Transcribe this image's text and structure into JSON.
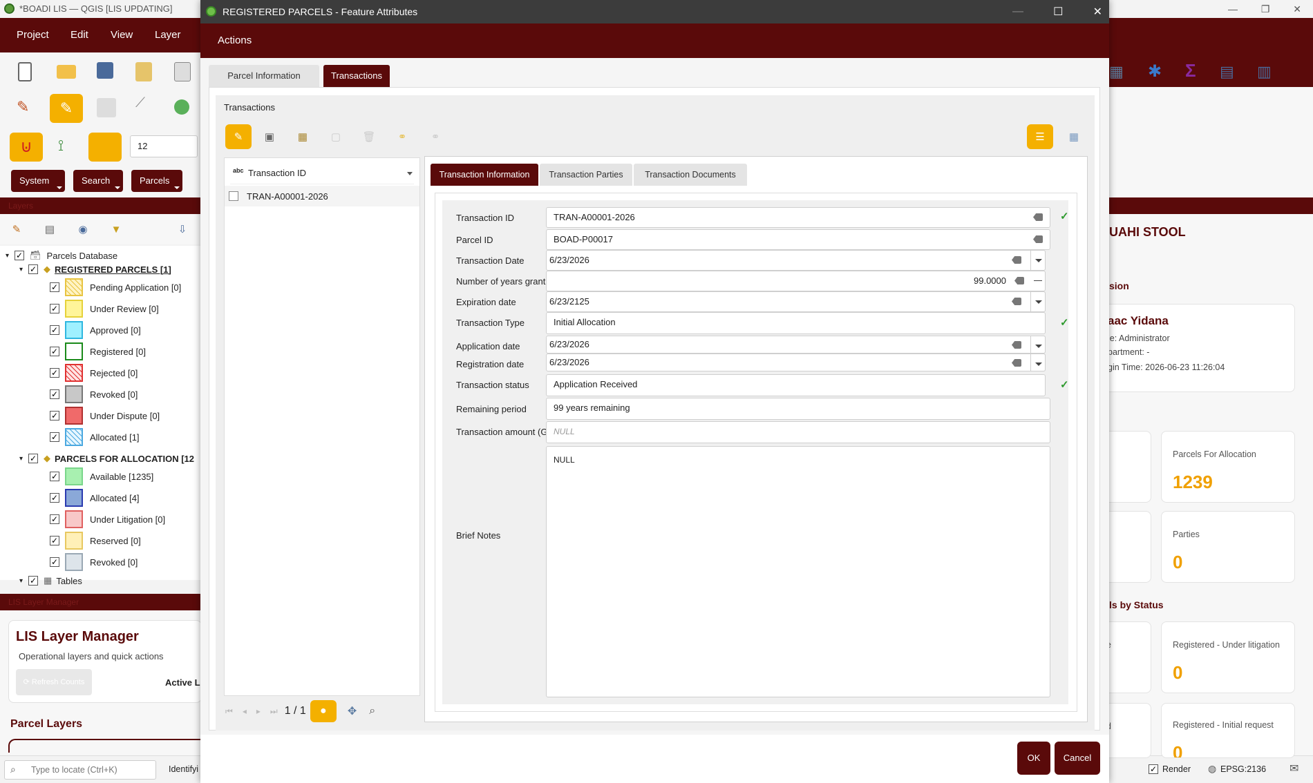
{
  "main_window": {
    "title": "*BOADI LIS — QGIS [LIS UPDATING]",
    "menu": [
      "Project",
      "Edit",
      "View",
      "Layer"
    ],
    "scale_value": "12",
    "quick_buttons": [
      "System",
      "Search",
      "Parcels"
    ],
    "layers_panel_title": "Layers",
    "layer_tree": {
      "root": "Parcels Database",
      "groups": [
        {
          "name": "REGISTERED PARCELS [1]",
          "items": [
            {
              "label": "Pending Application [0]",
              "color": "#fff3c4",
              "border": "#e8c440"
            },
            {
              "label": "Under Review [0]",
              "color": "#fff59a",
              "border": "#e6d23a"
            },
            {
              "label": "Approved [0]",
              "color": "#9ff0ff",
              "border": "#2fb7e0"
            },
            {
              "label": "Registered [0]",
              "color": "#ffffff",
              "border": "#1a8a1a"
            },
            {
              "label": "Rejected [0]",
              "color": "#ffe2e2",
              "border": "#e03030"
            },
            {
              "label": "Revoked [0]",
              "color": "#c8c8c8",
              "border": "#777777"
            },
            {
              "label": "Under Dispute [0]",
              "color": "#f06a6a",
              "border": "#b03030"
            },
            {
              "label": "Allocated [1]",
              "color": "#e6f6ff",
              "border": "#4aa8e0"
            }
          ]
        },
        {
          "name": "PARCELS FOR ALLOCATION [12",
          "items": [
            {
              "label": "Available [1235]",
              "color": "#a8f0b0",
              "border": "#7ad68a"
            },
            {
              "label": "Allocated [4]",
              "color": "#8aa8d8",
              "border": "#2a3ab0"
            },
            {
              "label": "Under Litigation [0]",
              "color": "#f8c8c8",
              "border": "#e06060"
            },
            {
              "label": "Reserved [0]",
              "color": "#fff0b8",
              "border": "#e8c860"
            },
            {
              "label": "Revoked [0]",
              "color": "#dde4ea",
              "border": "#9aa8b4"
            }
          ]
        }
      ],
      "tables_label": "Tables"
    },
    "layer_manager": {
      "panel_title": "LIS Layer Manager",
      "heading": "LIS Layer Manager",
      "subtitle": "Operational layers and quick actions",
      "refresh_button": "⟳ Refresh Counts",
      "active_label": "Active La",
      "parcel_layers_heading": "Parcel Layers"
    },
    "status_bar": {
      "locate_placeholder": "Type to locate (Ctrl+K)",
      "identify_label": "Identifyi",
      "render_label": "Render",
      "crs": "EPSG:2136"
    }
  },
  "dashboard": {
    "stool_name": "UAHI STOOL",
    "section_session": "sion",
    "user_name": "aac Yidana",
    "role": "le: Administrator",
    "department": "partment: -",
    "login_time": "gin Time: 2026-06-23 11:26:04",
    "status_heading": "ls by Status",
    "cards": [
      {
        "label": "Parcels For Allocation",
        "value": "1239"
      },
      {
        "label": "Parties",
        "value": "0"
      },
      {
        "label": "Registered - Under litigation",
        "value": "0"
      },
      {
        "label": "Registered - Initial request",
        "value": "0"
      }
    ],
    "partial_labels": [
      "e",
      "d"
    ],
    "accent": "#f0a000"
  },
  "dialog": {
    "title": "REGISTERED PARCELS - Feature Attributes",
    "actions_label": "Actions",
    "top_tabs": [
      "Parcel Information",
      "Transactions"
    ],
    "active_top_tab": "Transactions",
    "section_label": "Transactions",
    "list_header": "Transaction ID",
    "list_prefix": "abc",
    "records": [
      "TRAN-A00001-2026"
    ],
    "pager": "1 / 1",
    "inner_tabs": [
      "Transaction Information",
      "Transaction Parties",
      "Transaction Documents"
    ],
    "fields": {
      "transaction_id": {
        "label": "Transaction ID",
        "value": "TRAN-A00001-2026"
      },
      "parcel_id": {
        "label": "Parcel ID",
        "value": "BOAD-P00017"
      },
      "transaction_date": {
        "label": "Transaction Date",
        "value": "6/23/2026"
      },
      "years_granted": {
        "label": "Number of years granted",
        "value": "99.0000"
      },
      "expiration_date": {
        "label": "Expiration date",
        "value": "6/23/2125"
      },
      "transaction_type": {
        "label": "Transaction Type",
        "value": "Initial Allocation"
      },
      "application_date": {
        "label": "Application date",
        "value": "6/23/2026"
      },
      "registration_date": {
        "label": "Registration date",
        "value": "6/23/2026"
      },
      "transaction_status": {
        "label": "Transaction status",
        "value": "Application Received"
      },
      "remaining_period": {
        "label": "Remaining period",
        "value": "99 years remaining"
      },
      "transaction_amount": {
        "label": "Transaction amount (GHS)",
        "placeholder": "NULL"
      },
      "brief_notes": {
        "label": "Brief Notes",
        "value": "NULL"
      }
    },
    "ok_label": "OK",
    "cancel_label": "Cancel"
  },
  "colors": {
    "brand_dark_red": "#5a0a0a",
    "accent_yellow": "#f4b000",
    "valid_green": "#2e9a2e"
  }
}
